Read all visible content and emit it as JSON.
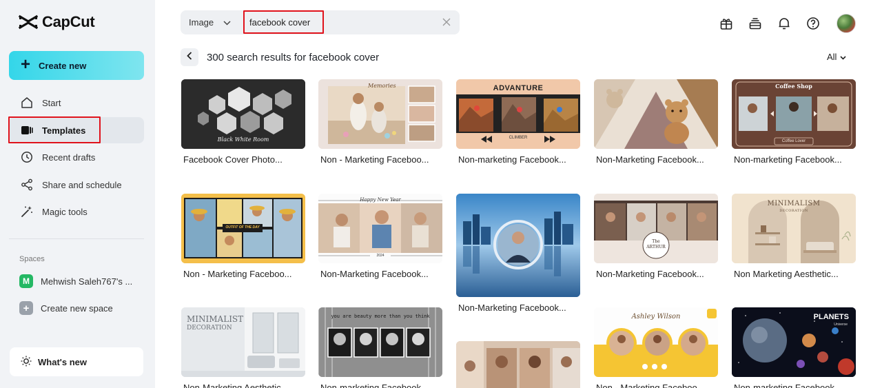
{
  "app": {
    "name": "CapCut"
  },
  "sidebar": {
    "create_label": "Create new",
    "items": [
      {
        "label": "Start",
        "icon": "home-icon"
      },
      {
        "label": "Templates",
        "icon": "templates-icon",
        "active": true
      },
      {
        "label": "Recent drafts",
        "icon": "clock-icon"
      },
      {
        "label": "Share and schedule",
        "icon": "share-icon"
      },
      {
        "label": "Magic tools",
        "icon": "magic-wand-icon"
      }
    ],
    "spaces_title": "Spaces",
    "space_name": "Mehwish Saleh767's ...",
    "space_initial": "M",
    "create_space_label": "Create new space",
    "whats_new_label": "What's new"
  },
  "search": {
    "type_label": "Image",
    "value": "facebook cover"
  },
  "results": {
    "title": "300 search results for facebook cover",
    "filter_label": "All"
  },
  "cards": [
    {
      "caption": "Facebook Cover Photo...",
      "thumb_text": "Black White Room"
    },
    {
      "caption": "Non - Marketing Faceboo...",
      "thumb_text": "Memories"
    },
    {
      "caption": "Non-marketing Facebook...",
      "thumb_text": "ADVANTURE",
      "thumb_sub": "CLIMBER"
    },
    {
      "caption": "Non-Marketing Facebook...",
      "thumb_text": ""
    },
    {
      "caption": "Non-marketing Facebook...",
      "thumb_text": "Coffee Shop",
      "thumb_sub": "Coffee Lover"
    },
    {
      "caption": "Non - Marketing Faceboo...",
      "thumb_text": "OUTFIT OF THE DAY"
    },
    {
      "caption": "Non-Marketing Facebook...",
      "thumb_text": "Happy New Year",
      "thumb_sub": "2024"
    },
    {
      "caption": "Non-Marketing Facebook...",
      "thumb_text": ""
    },
    {
      "caption": "Non-Marketing Facebook...",
      "thumb_text": "The ARTHUR"
    },
    {
      "caption": "Non Marketing Aesthetic...",
      "thumb_text": "MINIMALISM",
      "thumb_sub": "DECORATION"
    },
    {
      "caption": "Non-Marketing Aesthetic...",
      "thumb_text": "MINIMALIST",
      "thumb_sub": "DECORATION"
    },
    {
      "caption": "Non-marketing Facebook...",
      "thumb_text": "you are beauty more than you think"
    },
    {
      "caption": "",
      "thumb_text": ""
    },
    {
      "caption": "Non - Marketing Faceboo...",
      "thumb_text": "Ashley Wilson"
    },
    {
      "caption": "Non-marketing Facebook...",
      "thumb_text": "PLANETS",
      "thumb_sub": "Universe"
    }
  ],
  "colors": {
    "accent": "#34d6e9",
    "highlight": "#e0121b",
    "sidebar_bg": "#f1f3f6"
  }
}
